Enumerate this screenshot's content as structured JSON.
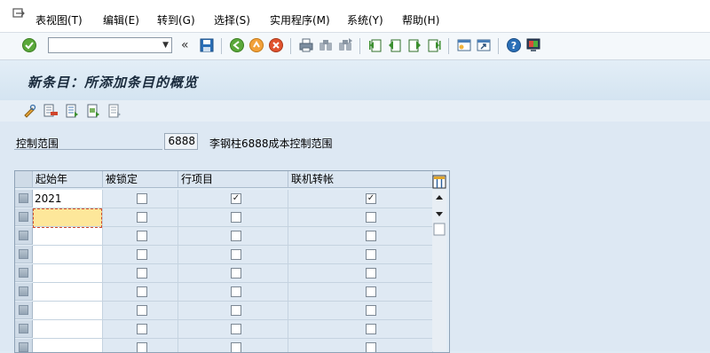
{
  "menu": {
    "items": [
      "表视图(T)",
      "编辑(E)",
      "转到(G)",
      "选择(S)",
      "实用程序(M)",
      "系统(Y)",
      "帮助(H)"
    ]
  },
  "toolbar": {
    "command_value": "",
    "command_placeholder": "",
    "icons": [
      "enter-check",
      "command-dropdown",
      "collapse-chevron",
      "save",
      "back",
      "exit",
      "cancel",
      "print",
      "find",
      "find-next",
      "first-page",
      "previous-page",
      "next-page",
      "last-page",
      "create-session",
      "create-shortcut",
      "help",
      "customize-layout"
    ]
  },
  "page": {
    "title": "新条目：所添加条目的概览"
  },
  "app_toolbar": {
    "icons": [
      "change-display-toggle",
      "delete-row",
      "select-all",
      "select-block",
      "deselect-all"
    ]
  },
  "header_fields": {
    "control_area_label": "控制范围",
    "control_area_value": "6888",
    "control_area_desc": "李钢柱6888成本控制范围"
  },
  "table": {
    "columns": [
      "起始年",
      "被锁定",
      "行项目",
      "联机转帐"
    ],
    "rows": [
      {
        "year": "2021",
        "locked": false,
        "line_items": true,
        "online_transfer": true
      },
      {
        "year": "",
        "locked": false,
        "line_items": false,
        "online_transfer": false
      },
      {
        "year": "",
        "locked": false,
        "line_items": false,
        "online_transfer": false
      },
      {
        "year": "",
        "locked": false,
        "line_items": false,
        "online_transfer": false
      },
      {
        "year": "",
        "locked": false,
        "line_items": false,
        "online_transfer": false
      },
      {
        "year": "",
        "locked": false,
        "line_items": false,
        "online_transfer": false
      },
      {
        "year": "",
        "locked": false,
        "line_items": false,
        "online_transfer": false
      },
      {
        "year": "",
        "locked": false,
        "line_items": false,
        "online_transfer": false
      },
      {
        "year": "",
        "locked": false,
        "line_items": false,
        "online_transfer": false
      }
    ],
    "check_mark": "✓"
  },
  "colors": {
    "background": "#dfebf5",
    "focus_cell": "#fde79a",
    "focus_frame": "#d24a2a"
  }
}
